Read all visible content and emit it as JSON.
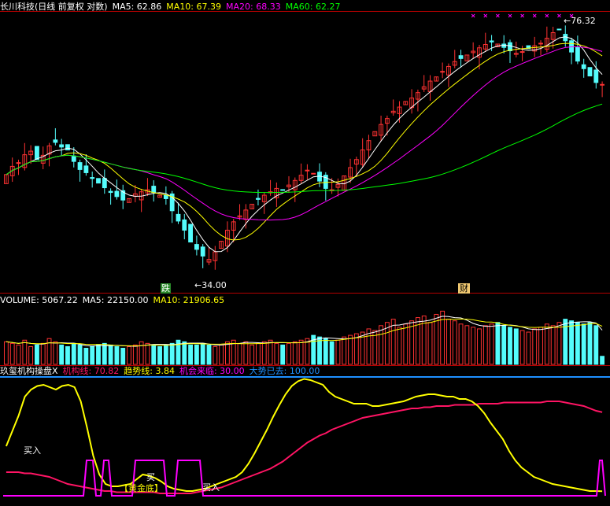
{
  "header": {
    "title": "长川科技(日线 前复权 对数)",
    "ma5": "MA5: 62.86",
    "ma10": "MA10: 67.39",
    "ma20": "MA20: 68.33",
    "ma60": "MA60: 62.27"
  },
  "volume_header": {
    "volume": "VOLUME: 5067.22",
    "ma5": "MA5: 22150.00",
    "ma10": "MA10: 21906.65"
  },
  "indicator_header": {
    "name": "玖玺机构操盘X",
    "inst": "机构线: 70.82",
    "trend": "趋势线: 3.84",
    "chance": "机会来临: 30.00",
    "gone": "大势已去: 100.00"
  },
  "annotations": {
    "high": "76.32",
    "low": "34.00",
    "die": "跌",
    "finance": "财",
    "buy1": "买入",
    "buy2": "买",
    "buy3": "买入",
    "golden": "【黄金底】"
  },
  "colors": {
    "up": "#ff3232",
    "down": "#54fcfc",
    "ma5": "#ffffff",
    "ma10": "#ffff00",
    "ma20": "#ff00ff",
    "ma60": "#00ff00",
    "inst": "#ff1464",
    "trend": "#ffff00",
    "signal": "#ff00ff",
    "refline": "#1e90ff",
    "grid": "#b40000"
  },
  "chart_data": [
    {
      "type": "candlestick",
      "title": "长川科技(日线 前复权 对数)",
      "ylim": [
        33,
        80
      ],
      "log_scale": true,
      "annotated_high": 76.32,
      "annotated_low": 34.0,
      "close": [
        46.5,
        47.8,
        48.4,
        49.7,
        50.3,
        48.9,
        49.6,
        51.2,
        51.8,
        51.0,
        50.5,
        48.6,
        47.3,
        46.8,
        45.9,
        45.2,
        44.5,
        43.8,
        43.2,
        42.7,
        42.9,
        43.6,
        43.9,
        44.2,
        43.8,
        43.4,
        42.9,
        41.2,
        39.8,
        38.6,
        37.1,
        36.2,
        35.4,
        35.0,
        35.9,
        37.2,
        38.6,
        39.7,
        40.5,
        41.3,
        42.1,
        42.8,
        43.4,
        43.9,
        44.4,
        44.1,
        44.9,
        45.6,
        46.4,
        47.2,
        46.7,
        45.5,
        44.4,
        44.2,
        45.0,
        46.3,
        47.6,
        48.9,
        50.5,
        52.1,
        53.7,
        55.0,
        56.1,
        57.5,
        58.3,
        59.4,
        60.1,
        61.2,
        62.4,
        63.6,
        64.5,
        65.7,
        66.8,
        67.9,
        68.6,
        69.4,
        70.3,
        71.1,
        71.9,
        72.5,
        72.0,
        71.2,
        70.4,
        69.8,
        70.2,
        70.9,
        71.6,
        72.2,
        73.4,
        74.8,
        75.6,
        72.8,
        70.1,
        68.0,
        66.3,
        64.7,
        63.3,
        62.9
      ],
      "ma5_last": 62.86,
      "ma10_last": 67.39,
      "ma20_last": 68.33,
      "ma60_last": 62.27
    },
    {
      "type": "bar",
      "title": "VOLUME",
      "last_volume": 5067.22,
      "ma5_last": 22150.0,
      "ma10_last": 21906.65,
      "values": [
        14,
        13,
        12,
        15,
        11,
        12,
        13,
        16,
        14,
        12,
        11,
        13,
        12,
        10,
        11,
        12,
        13,
        12,
        11,
        10,
        11,
        12,
        14,
        13,
        12,
        11,
        12,
        13,
        15,
        14,
        12,
        12,
        13,
        12,
        11,
        12,
        14,
        15,
        13,
        14,
        12,
        13,
        14,
        15,
        13,
        12,
        13,
        14,
        15,
        16,
        18,
        17,
        16,
        14,
        15,
        17,
        18,
        19,
        20,
        22,
        21,
        24,
        26,
        28,
        23,
        25,
        27,
        29,
        30,
        26,
        31,
        33,
        28,
        27,
        25,
        24,
        23,
        22,
        24,
        25,
        26,
        24,
        23,
        22,
        21,
        20,
        22,
        23,
        25,
        24,
        26,
        28,
        27,
        26,
        25,
        26,
        24,
        5
      ]
    },
    {
      "type": "line",
      "title": "玖玺机构操盘X",
      "ylim": [
        0,
        100
      ],
      "series": [
        {
          "name": "机构线",
          "last": 70.82,
          "values": [
            20,
            20,
            20,
            19,
            19,
            18,
            17,
            16,
            14,
            12,
            10,
            9,
            8,
            7,
            6,
            5,
            4,
            4,
            3,
            3,
            3,
            3,
            3,
            3,
            3,
            2,
            2,
            2,
            2,
            2,
            2,
            3,
            4,
            5,
            6,
            7,
            9,
            11,
            13,
            15,
            17,
            19,
            21,
            23,
            26,
            29,
            33,
            37,
            41,
            45,
            48,
            51,
            53,
            56,
            58,
            60,
            62,
            64,
            66,
            67,
            68,
            69,
            70,
            71,
            72,
            73,
            74,
            74,
            75,
            75,
            76,
            76,
            76,
            77,
            77,
            77,
            77,
            78,
            78,
            78,
            78,
            79,
            79,
            79,
            79,
            79,
            79,
            79,
            80,
            80,
            80,
            79,
            78,
            77,
            76,
            74,
            72,
            70.82
          ]
        },
        {
          "name": "趋势线",
          "last": 3.84,
          "values": [
            42,
            55,
            68,
            84,
            90,
            93,
            94,
            92,
            90,
            93,
            94,
            92,
            80,
            58,
            34,
            18,
            10,
            8,
            8,
            9,
            10,
            14,
            18,
            17,
            15,
            12,
            8,
            6,
            5,
            4,
            4,
            5,
            6,
            8,
            10,
            12,
            14,
            16,
            20,
            27,
            36,
            46,
            56,
            67,
            77,
            86,
            93,
            97,
            99,
            98,
            96,
            94,
            88,
            84,
            82,
            80,
            78,
            78,
            78,
            76,
            76,
            77,
            78,
            79,
            80,
            82,
            84,
            85,
            86,
            86,
            85,
            84,
            84,
            82,
            82,
            80,
            76,
            70,
            62,
            55,
            48,
            38,
            30,
            24,
            20,
            16,
            14,
            12,
            10,
            9,
            8,
            7,
            6,
            5,
            4,
            4,
            3.84
          ]
        },
        {
          "name": "机会来临",
          "value": 30.0
        },
        {
          "name": "大势已去",
          "value": 100.0
        }
      ]
    }
  ]
}
